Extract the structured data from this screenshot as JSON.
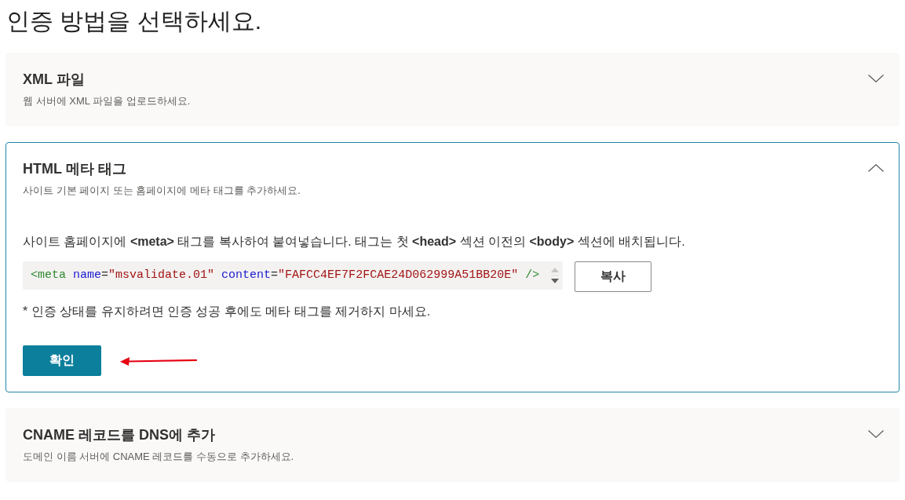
{
  "page_title": "인증 방법을 선택하세요.",
  "methods": [
    {
      "title": "XML 파일",
      "description": "웹 서버에 XML 파일을 업로드하세요.",
      "expanded": false
    },
    {
      "title": "HTML 메타 태그",
      "description": "사이트 기본 페이지 또는 홈페이지에 메타 태그를 추가하세요.",
      "expanded": true,
      "instructions": "사이트 홈페이지에 **<meta>** 태그를 복사하여 붙여넣습니다. 태그는 첫 **<head>** 섹션 이전의 **<body>** 섹션에 배치됩니다.",
      "code": [
        {
          "kind": "tag",
          "text": "<meta"
        },
        {
          "kind": "attribute",
          "text": " name"
        },
        {
          "kind": "punctuation",
          "text": "="
        },
        {
          "kind": "string",
          "text": "\"msvalidate.01\""
        },
        {
          "kind": "attribute",
          "text": " content"
        },
        {
          "kind": "punctuation",
          "text": "="
        },
        {
          "kind": "string",
          "text": "\"FAFCC4EF7F2FCAE24D062999A51BB20E\""
        },
        {
          "kind": "tag",
          "text": " />"
        }
      ],
      "copy_button": "복사",
      "note": "* 인증 상태를 유지하려면 인증 성공 후에도 메타 태그를 제거하지 마세요.",
      "verify_button": "확인"
    },
    {
      "title": "CNAME 레코드를 DNS에 추가",
      "description": "도메인 이름 서버에 CNAME 레코드를 수동으로 추가하세요.",
      "expanded": false
    }
  ]
}
